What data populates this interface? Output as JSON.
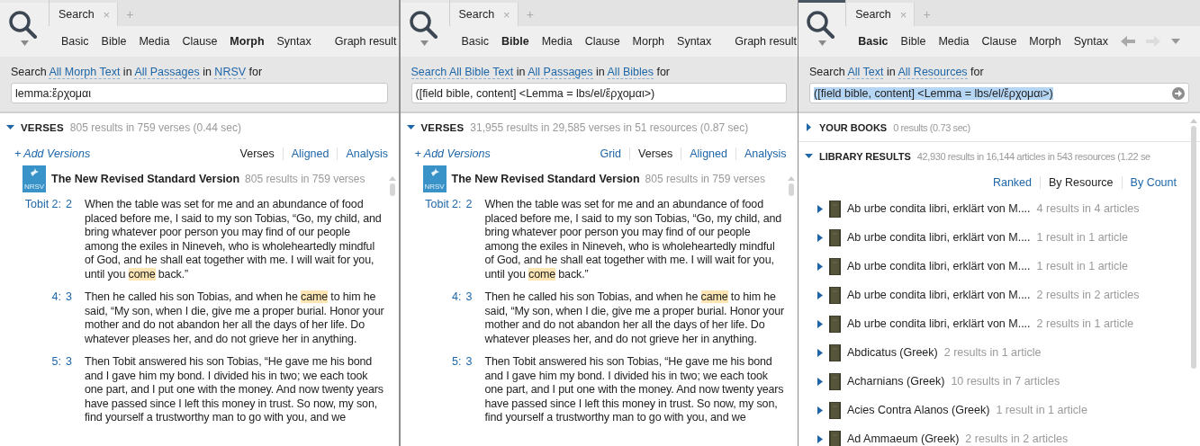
{
  "panels": [
    {
      "kind": "verses",
      "active": false,
      "tab": {
        "label": "Search",
        "close": "×"
      },
      "new_tab": "+",
      "search_types": [
        {
          "label": "Basic",
          "selected": false
        },
        {
          "label": "Bible",
          "selected": false
        },
        {
          "label": "Media",
          "selected": false
        },
        {
          "label": "Clause",
          "selected": false
        },
        {
          "label": "Morph",
          "selected": true
        },
        {
          "label": "Syntax",
          "selected": false
        }
      ],
      "graph_result": "Graph result",
      "query": [
        {
          "text": "Search",
          "link": false
        },
        {
          "text": "All Morph Text",
          "link": true
        },
        {
          "text": "in",
          "link": false
        },
        {
          "text": "All Passages",
          "link": true
        },
        {
          "text": "in",
          "link": false
        },
        {
          "text": "NRSV",
          "link": true
        },
        {
          "text": "for",
          "link": false
        }
      ],
      "input": {
        "value": "lemma:ἔρχομαι",
        "highlighted": false
      },
      "sections": [
        {
          "title": "VERSES",
          "summary": "805 results in 759 verses (0.44 sec)",
          "expanded": true
        }
      ],
      "add_versions": "+ Add Versions",
      "views": [
        {
          "label": "Verses",
          "selected": true
        },
        {
          "label": "Aligned",
          "selected": false
        },
        {
          "label": "Analysis",
          "selected": false
        }
      ],
      "version": {
        "logo": "NRSV",
        "title": "The New Revised Standard Version",
        "summary": "805 results in 759 verses"
      },
      "verses": [
        {
          "ref": "Tobit 2:",
          "verse": "2",
          "segments": [
            {
              "text": "When the table was set for me and an abundance of food placed before me, I said to my son Tobias, “Go, my child, and bring whatever poor person you may find of our people among the exiles in Nineveh, who is wholeheartedly mindful of God, and he shall eat together with me. I will wait for you, until you ",
              "hit": false
            },
            {
              "text": "come",
              "hit": true
            },
            {
              "text": " back.”",
              "hit": false
            }
          ]
        },
        {
          "ref": "4:",
          "verse": "3",
          "segments": [
            {
              "text": "Then he called his son Tobias, and when he ",
              "hit": false
            },
            {
              "text": "came",
              "hit": true
            },
            {
              "text": " to him he said, “My son, when I die, give me a proper burial. Honor your mother and do not abandon her all the days of her life. Do whatever pleases her, and do not grieve her in anything.",
              "hit": false
            }
          ]
        },
        {
          "ref": "5:",
          "verse": "3",
          "segments": [
            {
              "text": "Then Tobit answered his son Tobias, “He gave me his bond and I gave him my bond. I divided his in two; we each took one part, and I put one with the money. And now twenty years have passed since I left this money in trust. So now, my son, find yourself a trustworthy man to go with you, and we",
              "hit": false
            }
          ]
        }
      ]
    },
    {
      "kind": "verses",
      "active": false,
      "tab": {
        "label": "Search",
        "close": "×"
      },
      "new_tab": "+",
      "search_types": [
        {
          "label": "Basic",
          "selected": false
        },
        {
          "label": "Bible",
          "selected": true
        },
        {
          "label": "Media",
          "selected": false
        },
        {
          "label": "Clause",
          "selected": false
        },
        {
          "label": "Morph",
          "selected": false
        },
        {
          "label": "Syntax",
          "selected": false
        }
      ],
      "graph_result": "Graph result",
      "query": [
        {
          "text": "Search All Bible Text",
          "link": true
        },
        {
          "text": "in",
          "link": false
        },
        {
          "text": "All Passages",
          "link": true
        },
        {
          "text": "in",
          "link": false
        },
        {
          "text": "All Bibles",
          "link": true
        },
        {
          "text": "for",
          "link": false
        }
      ],
      "input": {
        "value": "([field bible, content] <Lemma = lbs/el/ἔρχομαι>)",
        "highlighted": false
      },
      "sections": [
        {
          "title": "VERSES",
          "summary": "31,955 results in 29,585 verses in 51 resources (0.87 sec)",
          "expanded": true
        }
      ],
      "add_versions": "+ Add Versions",
      "views": [
        {
          "label": "Grid",
          "selected": false
        },
        {
          "label": "Verses",
          "selected": true
        },
        {
          "label": "Aligned",
          "selected": false
        },
        {
          "label": "Analysis",
          "selected": false
        }
      ],
      "version": {
        "logo": "NRSV",
        "title": "The New Revised Standard Version",
        "summary": "805 results in 759 verses"
      },
      "verses": [
        {
          "ref": "Tobit 2:",
          "verse": "2",
          "segments": [
            {
              "text": "When the table was set for me and an abundance of food placed before me, I said to my son Tobias, “Go, my child, and bring whatever poor person you may find of our people among the exiles in Nineveh, who is wholeheartedly mindful of God, and he shall eat together with me. I will wait for you, until you ",
              "hit": false
            },
            {
              "text": "come",
              "hit": true
            },
            {
              "text": " back.”",
              "hit": false
            }
          ]
        },
        {
          "ref": "4:",
          "verse": "3",
          "segments": [
            {
              "text": "Then he called his son Tobias, and when he ",
              "hit": false
            },
            {
              "text": "came",
              "hit": true
            },
            {
              "text": " to him he said, “My son, when I die, give me a proper burial. Honor your mother and do not abandon her all the days of her life. Do whatever pleases her, and do not grieve her in anything.",
              "hit": false
            }
          ]
        },
        {
          "ref": "5:",
          "verse": "3",
          "segments": [
            {
              "text": "Then Tobit answered his son Tobias, “He gave me his bond and I gave him my bond. I divided his in two; we each took one part, and I put one with the money. And now twenty years have passed since I left this money in trust. So now, my son, find yourself a trustworthy man to go with you, and we",
              "hit": false
            }
          ]
        }
      ]
    },
    {
      "kind": "library",
      "active": true,
      "tab": {
        "label": "Search",
        "close": "×"
      },
      "new_tab": "+",
      "search_types": [
        {
          "label": "Basic",
          "selected": true
        },
        {
          "label": "Bible",
          "selected": false
        },
        {
          "label": "Media",
          "selected": false
        },
        {
          "label": "Clause",
          "selected": false
        },
        {
          "label": "Morph",
          "selected": false
        },
        {
          "label": "Syntax",
          "selected": false
        }
      ],
      "query": [
        {
          "text": "Search",
          "link": false
        },
        {
          "text": "All Text",
          "link": true
        },
        {
          "text": "in",
          "link": false
        },
        {
          "text": "All Resources",
          "link": true
        },
        {
          "text": "for",
          "link": false
        }
      ],
      "input": {
        "value": "([field bible, content] <Lemma = lbs/el/ἔρχομαι>)",
        "highlighted": true
      },
      "sections": [
        {
          "title": "YOUR BOOKS",
          "summary": "0 results (0.73 sec)",
          "expanded": false
        },
        {
          "title": "LIBRARY RESULTS",
          "summary": "42,930 results in 16,144 articles in 543 resources (1.22 se",
          "expanded": true
        }
      ],
      "views": [
        {
          "label": "Ranked",
          "selected": false
        },
        {
          "label": "By Resource",
          "selected": true
        },
        {
          "label": "By Count",
          "selected": false
        }
      ],
      "books": [
        {
          "title": "Ab urbe condita libri, erklärt von M....",
          "count": "4 results in 4 articles"
        },
        {
          "title": "Ab urbe condita libri, erklärt von M....",
          "count": "1 result in 1 article"
        },
        {
          "title": "Ab urbe condita libri, erklärt von M....",
          "count": "1 result in 1 article"
        },
        {
          "title": "Ab urbe condita libri, erklärt von M....",
          "count": "2 results in 2 articles"
        },
        {
          "title": "Ab urbe condita libri, erklärt von M....",
          "count": "2 results in 1 article"
        },
        {
          "title": "Abdicatus (Greek)",
          "count": "2 results in 1 article"
        },
        {
          "title": "Acharnians (Greek)",
          "count": "10 results in 7 articles"
        },
        {
          "title": "Acies Contra Alanos (Greek)",
          "count": "1 result in 1 article"
        },
        {
          "title": "Ad Ammaeum (Greek)",
          "count": "2 results in 2 articles"
        }
      ]
    }
  ]
}
